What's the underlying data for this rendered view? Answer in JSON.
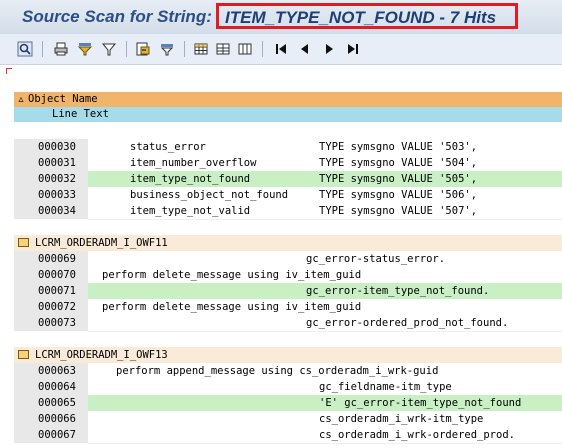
{
  "window": {
    "title_prefix": "Source Scan for String: ",
    "title_highlight": "ITEM_TYPE_NOT_FOUND - 7 Hits"
  },
  "toolbar": {
    "buttons": [
      "find-icon",
      "print-icon",
      "filter-icon",
      "filter-funnel-icon",
      "export-icon",
      "layout-icon",
      "grid-icon",
      "first-page-icon",
      "previous-page-icon",
      "next-page-icon",
      "last-page-icon"
    ]
  },
  "header": {
    "object_name": "Object Name",
    "line_text": "Line Text"
  },
  "groups": [
    {
      "program": "",
      "rows": [
        {
          "line": "000030",
          "code": "status_error",
          "code2": "TYPE symsgno VALUE '503',",
          "hit": false
        },
        {
          "line": "000031",
          "code": "item_number_overflow",
          "code2": "TYPE symsgno VALUE '504',",
          "hit": false
        },
        {
          "line": "000032",
          "code": "item_type_not_found",
          "code2": "TYPE symsgno VALUE '505',",
          "hit": true
        },
        {
          "line": "000033",
          "code": "business_object_not_found",
          "code2": "TYPE symsgno VALUE '506',",
          "hit": false
        },
        {
          "line": "000034",
          "code": "item_type_not_valid",
          "code2": "TYPE symsgno VALUE '507',",
          "hit": false
        }
      ]
    },
    {
      "program": "LCRM_ORDERADM_I_OWF11",
      "rows": [
        {
          "line": "000069",
          "code": "",
          "code2": "gc_error-status_error.",
          "hit": false
        },
        {
          "line": "000070",
          "code": "perform delete_message using iv_item_guid",
          "code2": "",
          "hit": false
        },
        {
          "line": "000071",
          "code": "",
          "code2": "gc_error-item_type_not_found.",
          "hit": true
        },
        {
          "line": "000072",
          "code": "perform delete_message using iv_item_guid",
          "code2": "",
          "hit": false
        },
        {
          "line": "000073",
          "code": "",
          "code2": "gc_error-ordered_prod_not_found.",
          "hit": false
        }
      ]
    },
    {
      "program": "LCRM_ORDERADM_I_OWF13",
      "rows": [
        {
          "line": "000063",
          "code": "perform append_message using cs_orderadm_i_wrk-guid",
          "code2": "",
          "hit": false
        },
        {
          "line": "000064",
          "code": "",
          "code2": "gc_fieldname-itm_type",
          "hit": false
        },
        {
          "line": "000065",
          "code": "",
          "code2": "'E' gc_error-item_type_not_found",
          "hit": true
        },
        {
          "line": "000066",
          "code": "",
          "code2": "cs_orderadm_i_wrk-itm_type",
          "hit": false
        },
        {
          "line": "000067",
          "code": "",
          "code2": "cs_orderadm_i_wrk-ordered_prod.",
          "hit": false
        }
      ]
    }
  ]
}
